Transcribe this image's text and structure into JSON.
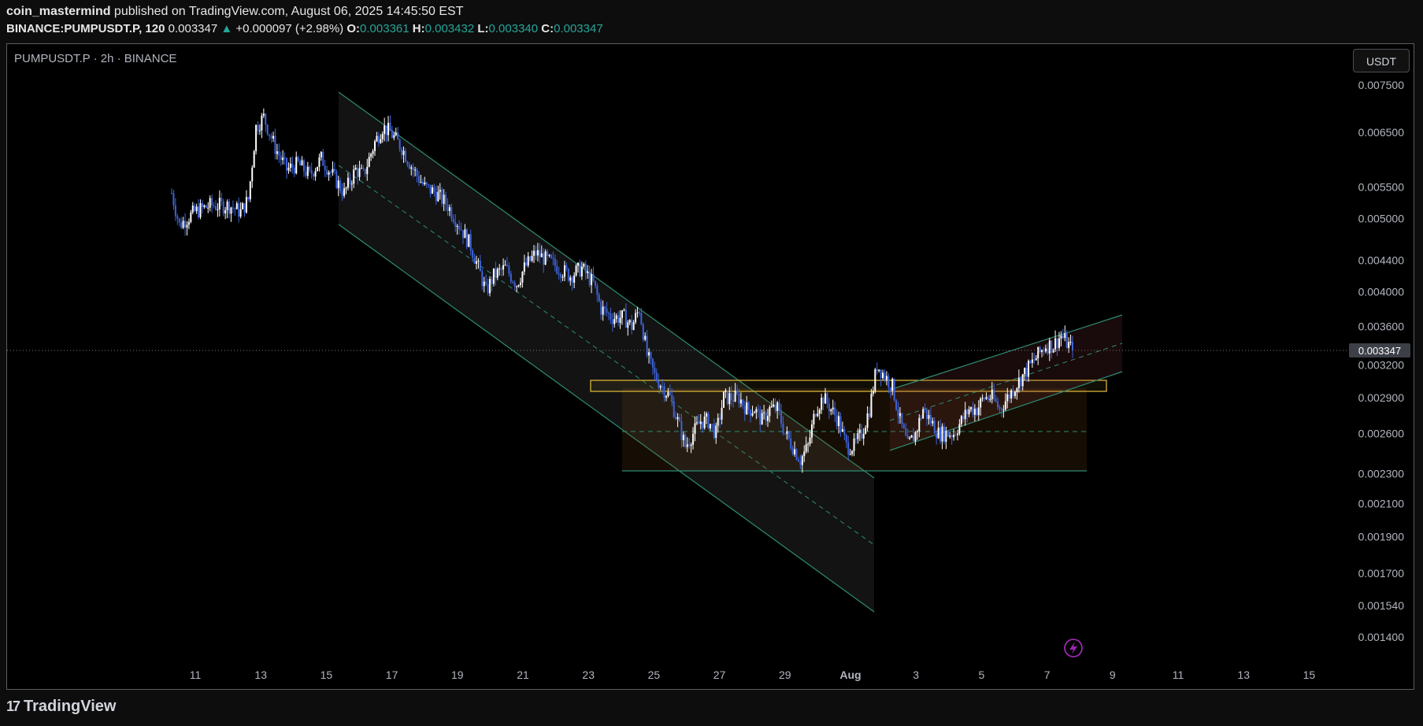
{
  "header": {
    "author": "coin_mastermind",
    "published_text": " published on TradingView.com, August 06, 2025 14:45:50 EST",
    "symbol_interval": "BINANCE:PUMPUSDT.P, 120",
    "last": "0.003347",
    "change_arrow": "▲",
    "change": "+0.000097 (+2.98%)",
    "open_label": "O:",
    "open": "0.003361",
    "high_label": "H:",
    "high": "0.003432",
    "low_label": "L:",
    "low": "0.003340",
    "close_label": "C:",
    "close": "0.003347"
  },
  "chart": {
    "symbol_label": "PUMPUSDT.P · 2h · BINANCE",
    "currency": "USDT",
    "last_price_label": "0.003347"
  },
  "colors": {
    "up": "#ffffff",
    "down": "#3d63d9",
    "channel_line": "#2f8a74",
    "box_border": "#d8b33a",
    "last_price_bg": "#3c3f47",
    "axis_text": "#b2b5be"
  },
  "brand": {
    "name": "TradingView",
    "logo_glyph": "17"
  },
  "chart_data": {
    "type": "candlestick",
    "scale": "log",
    "y_ticks": [
      "0.007500",
      "0.006500",
      "0.005500",
      "0.005000",
      "0.004400",
      "0.004000",
      "0.003600",
      "0.003200",
      "0.002900",
      "0.002600",
      "0.002300",
      "0.002100",
      "0.001900",
      "0.001700",
      "0.001540",
      "0.001400"
    ],
    "x_ticks": [
      "11",
      "13",
      "15",
      "17",
      "19",
      "21",
      "23",
      "25",
      "27",
      "29",
      "Aug",
      "3",
      "5",
      "7",
      "9",
      "11",
      "13",
      "15"
    ],
    "last_price": 0.003347,
    "price_path": [
      [
        0,
        0.0054
      ],
      [
        4,
        0.0049
      ],
      [
        12,
        0.0051
      ],
      [
        20,
        0.0052
      ],
      [
        30,
        0.0052
      ],
      [
        36,
        0.0051
      ],
      [
        40,
        0.0053
      ],
      [
        44,
        0.0066
      ],
      [
        48,
        0.0068
      ],
      [
        54,
        0.0062
      ],
      [
        60,
        0.0058
      ],
      [
        66,
        0.0059
      ],
      [
        72,
        0.0057
      ],
      [
        78,
        0.006
      ],
      [
        84,
        0.0057
      ],
      [
        90,
        0.0054
      ],
      [
        96,
        0.0058
      ],
      [
        100,
        0.0057
      ],
      [
        106,
        0.0063
      ],
      [
        110,
        0.0066
      ],
      [
        114,
        0.0065
      ],
      [
        120,
        0.0062
      ],
      [
        126,
        0.0058
      ],
      [
        132,
        0.0055
      ],
      [
        138,
        0.0054
      ],
      [
        144,
        0.0052
      ],
      [
        150,
        0.0049
      ],
      [
        156,
        0.0046
      ],
      [
        160,
        0.0043
      ],
      [
        164,
        0.004
      ],
      [
        168,
        0.0042
      ],
      [
        174,
        0.0043
      ],
      [
        180,
        0.0041
      ],
      [
        184,
        0.0043
      ],
      [
        190,
        0.0045
      ],
      [
        196,
        0.0044
      ],
      [
        202,
        0.0043
      ],
      [
        208,
        0.0042
      ],
      [
        214,
        0.0043
      ],
      [
        220,
        0.0041
      ],
      [
        224,
        0.0038
      ],
      [
        230,
        0.0037
      ],
      [
        236,
        0.0037
      ],
      [
        240,
        0.0036
      ],
      [
        244,
        0.0038
      ],
      [
        248,
        0.0033
      ],
      [
        252,
        0.0031
      ],
      [
        256,
        0.003
      ],
      [
        260,
        0.0029
      ],
      [
        264,
        0.0027
      ],
      [
        268,
        0.0025
      ],
      [
        272,
        0.0026
      ],
      [
        276,
        0.0027
      ],
      [
        280,
        0.0027
      ],
      [
        284,
        0.0026
      ],
      [
        288,
        0.0029
      ],
      [
        292,
        0.0029
      ],
      [
        296,
        0.0029
      ],
      [
        300,
        0.0028
      ],
      [
        304,
        0.0028
      ],
      [
        308,
        0.0027
      ],
      [
        312,
        0.0028
      ],
      [
        316,
        0.0028
      ],
      [
        320,
        0.0026
      ],
      [
        324,
        0.0025
      ],
      [
        328,
        0.0024
      ],
      [
        332,
        0.0025
      ],
      [
        336,
        0.0028
      ],
      [
        340,
        0.0029
      ],
      [
        344,
        0.0028
      ],
      [
        348,
        0.0027
      ],
      [
        352,
        0.0025
      ],
      [
        356,
        0.0025
      ],
      [
        360,
        0.0026
      ],
      [
        364,
        0.0028
      ],
      [
        368,
        0.0032
      ],
      [
        372,
        0.0031
      ],
      [
        376,
        0.003
      ],
      [
        380,
        0.0027
      ],
      [
        384,
        0.0025
      ],
      [
        388,
        0.0026
      ],
      [
        392,
        0.0028
      ],
      [
        396,
        0.0027
      ],
      [
        400,
        0.0026
      ],
      [
        404,
        0.0026
      ],
      [
        408,
        0.0026
      ],
      [
        412,
        0.0027
      ],
      [
        416,
        0.0028
      ],
      [
        420,
        0.0028
      ],
      [
        424,
        0.0029
      ],
      [
        428,
        0.0029
      ],
      [
        432,
        0.0028
      ],
      [
        436,
        0.0029
      ],
      [
        440,
        0.003
      ],
      [
        444,
        0.0031
      ],
      [
        448,
        0.0032
      ],
      [
        452,
        0.0033
      ],
      [
        456,
        0.0034
      ],
      [
        460,
        0.0034
      ],
      [
        464,
        0.0035
      ],
      [
        468,
        0.0034
      ],
      [
        470,
        0.003347
      ]
    ],
    "drawings": {
      "descending_channel": "parallel channel from Jul 15 to Jul 31",
      "rectangle_range": "range box Jul 24 – Aug 7, 0.00232 to 0.00295",
      "resistance_zone": "horizontal zone ~0.00295 to 0.00306",
      "ascending_channel": "rising channel Aug 1 – Aug 8"
    }
  }
}
